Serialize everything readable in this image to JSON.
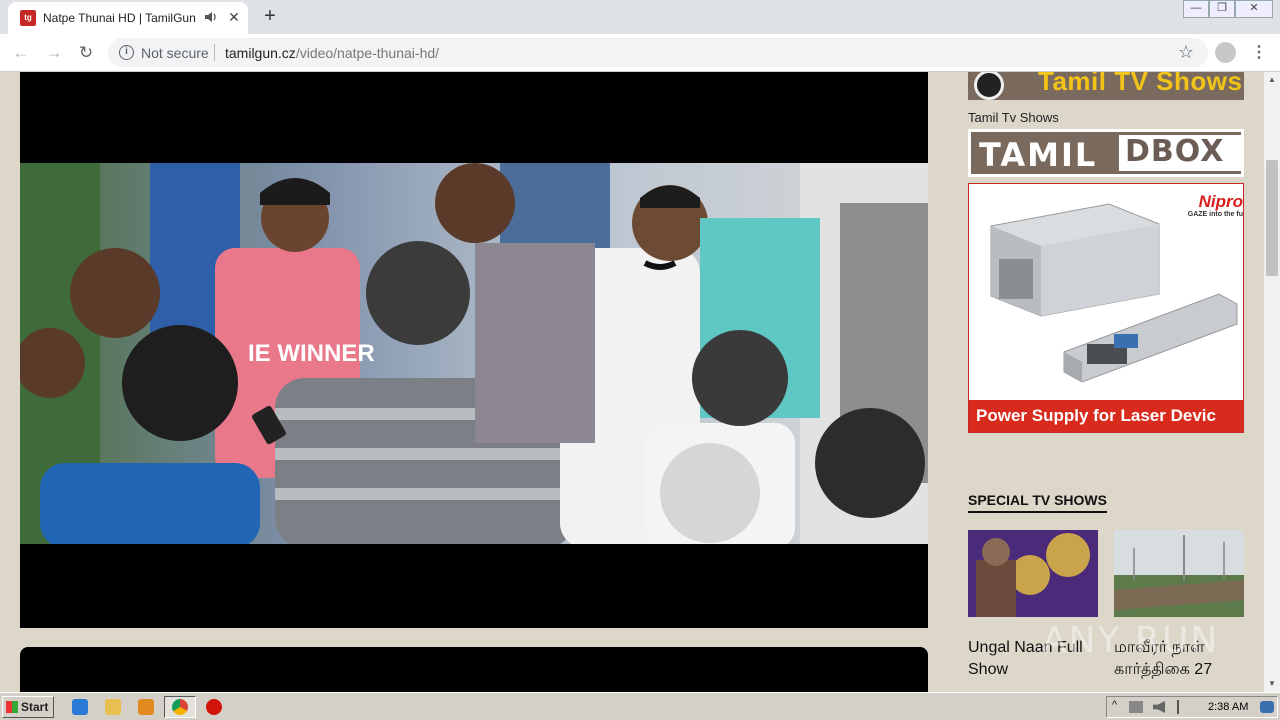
{
  "browser": {
    "tab_title": "Natpe Thunai HD | TamilGun",
    "tab_favicon": "tamilgun-favicon",
    "tab_audio_icon": "speaker-icon",
    "new_tab_label": "+",
    "window_controls": {
      "minimize": "—",
      "restore": "❐",
      "close": "✕"
    },
    "security_label": "Not secure",
    "url_host": "tamilgun.cz",
    "url_path": "/video/natpe-thunai-hd/"
  },
  "sidebar": {
    "banner_tv_text": "Tamil TV Shows",
    "caption": "Tamil Tv Shows",
    "dbox_left": "TAMIL",
    "dbox_right": "DBOX",
    "ad": {
      "brand": "Nipro",
      "tagline": "GAZE into the fu",
      "bottom_text": "Power Supply for Laser Devic"
    },
    "section_title": "SPECIAL TV SHOWS",
    "shows": [
      {
        "title": "Ungal Naan Full Show"
      },
      {
        "title": "மாவீரர் நாள் கார்த்திகை 27"
      }
    ]
  },
  "watermark": "ANY RUN",
  "taskbar": {
    "start_label": "Start",
    "clock": "2:38 AM"
  },
  "colors": {
    "page_bg": "#ddd7ca",
    "ad_red": "#d92a1e",
    "banner_brown": "#7a6a5e",
    "banner_yellow": "#f2c318"
  }
}
